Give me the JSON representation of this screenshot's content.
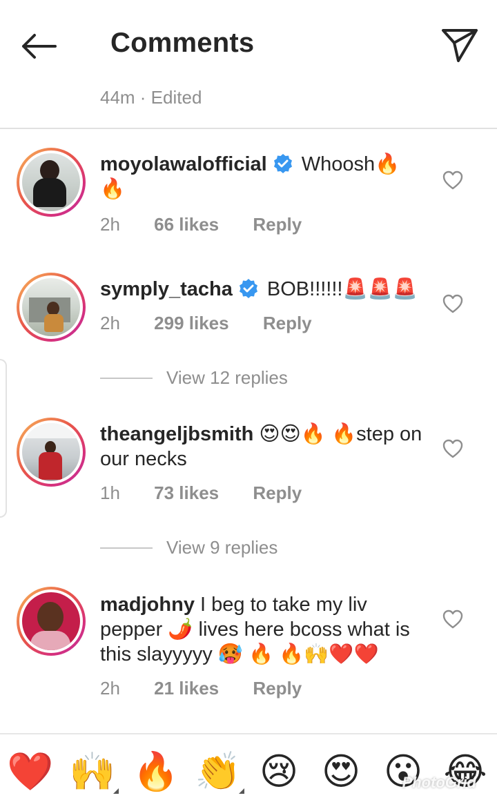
{
  "header": {
    "title": "Comments",
    "meta": "44m · Edited"
  },
  "comments": [
    {
      "username": "moyolawalofficial",
      "verified": true,
      "text": "Whoosh🔥🔥",
      "time": "2h",
      "likes": "66 likes",
      "reply": "Reply"
    },
    {
      "username": "symply_tacha",
      "verified": true,
      "text": "BOB!!!!!!🚨🚨🚨",
      "time": "2h",
      "likes": "299 likes",
      "reply": "Reply"
    },
    {
      "username": "theangeljbsmith",
      "verified": false,
      "text": "😍😍🔥 🔥step on our necks",
      "time": "1h",
      "likes": "73 likes",
      "reply": "Reply"
    },
    {
      "username": "madjohny",
      "verified": false,
      "text": "I beg to take my liv pepper 🌶️ lives here bcoss what is this slayyyyy 🥵 🔥 🔥🙌❤️❤️",
      "time": "2h",
      "likes": "21 likes",
      "reply": "Reply"
    }
  ],
  "view_replies": [
    {
      "label": "View 12 replies"
    },
    {
      "label": "View 9 replies"
    }
  ],
  "emoji_bar": [
    {
      "name": "red-heart",
      "glyph": "❤️"
    },
    {
      "name": "raising-hands",
      "glyph": "🙌"
    },
    {
      "name": "fire",
      "glyph": "🔥"
    },
    {
      "name": "clapping-hands",
      "glyph": "👏"
    },
    {
      "name": "crying-face",
      "glyph": "😢"
    },
    {
      "name": "heart-eyes",
      "glyph": "😍"
    },
    {
      "name": "surprised-face",
      "glyph": "😮"
    },
    {
      "name": "tears-of-joy",
      "glyph": "😂"
    }
  ],
  "watermark": "PhotoGrid",
  "colors": {
    "text": "#262626",
    "secondary": "#8e8e8e",
    "verified": "#3897f0",
    "ring_start": "#f9b95a",
    "ring_end": "#c1339c"
  }
}
